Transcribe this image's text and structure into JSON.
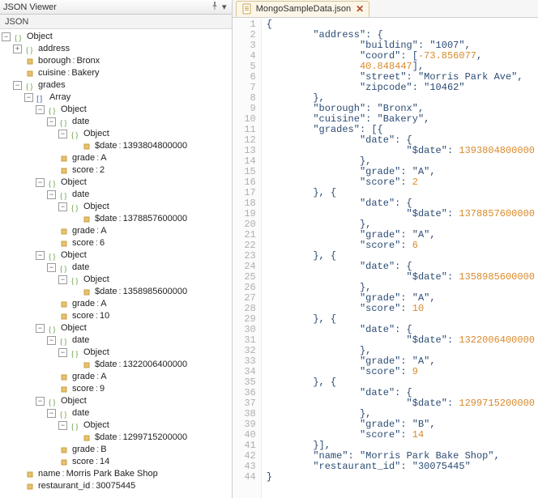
{
  "left": {
    "title": "JSON Viewer",
    "column_header": "JSON",
    "tree": {
      "root_label": "Object",
      "address_label": "address",
      "borough_label": "borough",
      "borough_value": "Bronx",
      "cuisine_label": "cuisine",
      "cuisine_value": "Bakery",
      "grades_label": "grades",
      "array_label": "Array",
      "object_label": "Object",
      "date_label": "date",
      "sdate_label": "$date",
      "grade_label": "grade",
      "score_label": "score",
      "grades": [
        {
          "sdate": "1393804800000",
          "grade": "A",
          "score": "2"
        },
        {
          "sdate": "1378857600000",
          "grade": "A",
          "score": "6"
        },
        {
          "sdate": "1358985600000",
          "grade": "A",
          "score": "10"
        },
        {
          "sdate": "1322006400000",
          "grade": "A",
          "score": "9"
        },
        {
          "sdate": "1299715200000",
          "grade": "B",
          "score": "14"
        }
      ],
      "name_label": "name",
      "name_value": "Morris Park Bake Shop",
      "rid_label": "restaurant_id",
      "rid_value": "30075445"
    }
  },
  "tab": {
    "filename": "MongoSampleData.json"
  },
  "chart_data": {
    "type": "table",
    "title": "Restaurant JSON document",
    "address": {
      "building": "1007",
      "coord": [
        -73.856077,
        40.848447
      ],
      "street": "Morris Park Ave",
      "zipcode": "10462"
    },
    "borough": "Bronx",
    "cuisine": "Bakery",
    "grades": [
      {
        "$date": 1393804800000,
        "grade": "A",
        "score": 2
      },
      {
        "$date": 1378857600000,
        "grade": "A",
        "score": 6
      },
      {
        "$date": 1358985600000,
        "grade": "A",
        "score": 10
      },
      {
        "$date": 1322006400000,
        "grade": "A",
        "score": 9
      },
      {
        "$date": 1299715200000,
        "grade": "B",
        "score": 14
      }
    ],
    "name": "Morris Park Bake Shop",
    "restaurant_id": "30075445"
  },
  "code": {
    "lines": [
      [
        [
          "punc",
          "{"
        ]
      ],
      [
        [
          "punc",
          "        "
        ],
        [
          "key",
          "\"address\""
        ],
        [
          "punc",
          ": {"
        ]
      ],
      [
        [
          "punc",
          "                "
        ],
        [
          "key",
          "\"building\""
        ],
        [
          "punc",
          ": "
        ],
        [
          "str",
          "\"1007\""
        ],
        [
          "punc",
          ","
        ]
      ],
      [
        [
          "punc",
          "                "
        ],
        [
          "key",
          "\"coord\""
        ],
        [
          "punc",
          ": ["
        ],
        [
          "num",
          "-73.856077"
        ],
        [
          "punc",
          ","
        ]
      ],
      [
        [
          "punc",
          "                "
        ],
        [
          "num",
          "40.848447"
        ],
        [
          "punc",
          "],"
        ]
      ],
      [
        [
          "punc",
          "                "
        ],
        [
          "key",
          "\"street\""
        ],
        [
          "punc",
          ": "
        ],
        [
          "str",
          "\"Morris Park Ave\""
        ],
        [
          "punc",
          ","
        ]
      ],
      [
        [
          "punc",
          "                "
        ],
        [
          "key",
          "\"zipcode\""
        ],
        [
          "punc",
          ": "
        ],
        [
          "str",
          "\"10462\""
        ]
      ],
      [
        [
          "punc",
          "        },"
        ]
      ],
      [
        [
          "punc",
          "        "
        ],
        [
          "key",
          "\"borough\""
        ],
        [
          "punc",
          ": "
        ],
        [
          "str",
          "\"Bronx\""
        ],
        [
          "punc",
          ","
        ]
      ],
      [
        [
          "punc",
          "        "
        ],
        [
          "key",
          "\"cuisine\""
        ],
        [
          "punc",
          ": "
        ],
        [
          "str",
          "\"Bakery\""
        ],
        [
          "punc",
          ","
        ]
      ],
      [
        [
          "punc",
          "        "
        ],
        [
          "key",
          "\"grades\""
        ],
        [
          "punc",
          ": [{"
        ]
      ],
      [
        [
          "punc",
          "                "
        ],
        [
          "key",
          "\"date\""
        ],
        [
          "punc",
          ": {"
        ]
      ],
      [
        [
          "punc",
          "                        "
        ],
        [
          "key",
          "\"$date\""
        ],
        [
          "punc",
          ": "
        ],
        [
          "num",
          "1393804800000"
        ]
      ],
      [
        [
          "punc",
          "                },"
        ]
      ],
      [
        [
          "punc",
          "                "
        ],
        [
          "key",
          "\"grade\""
        ],
        [
          "punc",
          ": "
        ],
        [
          "str",
          "\"A\""
        ],
        [
          "punc",
          ","
        ]
      ],
      [
        [
          "punc",
          "                "
        ],
        [
          "key",
          "\"score\""
        ],
        [
          "punc",
          ": "
        ],
        [
          "num",
          "2"
        ]
      ],
      [
        [
          "punc",
          "        }, {"
        ]
      ],
      [
        [
          "punc",
          "                "
        ],
        [
          "key",
          "\"date\""
        ],
        [
          "punc",
          ": {"
        ]
      ],
      [
        [
          "punc",
          "                        "
        ],
        [
          "key",
          "\"$date\""
        ],
        [
          "punc",
          ": "
        ],
        [
          "num",
          "1378857600000"
        ]
      ],
      [
        [
          "punc",
          "                },"
        ]
      ],
      [
        [
          "punc",
          "                "
        ],
        [
          "key",
          "\"grade\""
        ],
        [
          "punc",
          ": "
        ],
        [
          "str",
          "\"A\""
        ],
        [
          "punc",
          ","
        ]
      ],
      [
        [
          "punc",
          "                "
        ],
        [
          "key",
          "\"score\""
        ],
        [
          "punc",
          ": "
        ],
        [
          "num",
          "6"
        ]
      ],
      [
        [
          "punc",
          "        }, {"
        ]
      ],
      [
        [
          "punc",
          "                "
        ],
        [
          "key",
          "\"date\""
        ],
        [
          "punc",
          ": {"
        ]
      ],
      [
        [
          "punc",
          "                        "
        ],
        [
          "key",
          "\"$date\""
        ],
        [
          "punc",
          ": "
        ],
        [
          "num",
          "1358985600000"
        ]
      ],
      [
        [
          "punc",
          "                },"
        ]
      ],
      [
        [
          "punc",
          "                "
        ],
        [
          "key",
          "\"grade\""
        ],
        [
          "punc",
          ": "
        ],
        [
          "str",
          "\"A\""
        ],
        [
          "punc",
          ","
        ]
      ],
      [
        [
          "punc",
          "                "
        ],
        [
          "key",
          "\"score\""
        ],
        [
          "punc",
          ": "
        ],
        [
          "num",
          "10"
        ]
      ],
      [
        [
          "punc",
          "        }, {"
        ]
      ],
      [
        [
          "punc",
          "                "
        ],
        [
          "key",
          "\"date\""
        ],
        [
          "punc",
          ": {"
        ]
      ],
      [
        [
          "punc",
          "                        "
        ],
        [
          "key",
          "\"$date\""
        ],
        [
          "punc",
          ": "
        ],
        [
          "num",
          "1322006400000"
        ]
      ],
      [
        [
          "punc",
          "                },"
        ]
      ],
      [
        [
          "punc",
          "                "
        ],
        [
          "key",
          "\"grade\""
        ],
        [
          "punc",
          ": "
        ],
        [
          "str",
          "\"A\""
        ],
        [
          "punc",
          ","
        ]
      ],
      [
        [
          "punc",
          "                "
        ],
        [
          "key",
          "\"score\""
        ],
        [
          "punc",
          ": "
        ],
        [
          "num",
          "9"
        ]
      ],
      [
        [
          "punc",
          "        }, {"
        ]
      ],
      [
        [
          "punc",
          "                "
        ],
        [
          "key",
          "\"date\""
        ],
        [
          "punc",
          ": {"
        ]
      ],
      [
        [
          "punc",
          "                        "
        ],
        [
          "key",
          "\"$date\""
        ],
        [
          "punc",
          ": "
        ],
        [
          "num",
          "1299715200000"
        ]
      ],
      [
        [
          "punc",
          "                },"
        ]
      ],
      [
        [
          "punc",
          "                "
        ],
        [
          "key",
          "\"grade\""
        ],
        [
          "punc",
          ": "
        ],
        [
          "str",
          "\"B\""
        ],
        [
          "punc",
          ","
        ]
      ],
      [
        [
          "punc",
          "                "
        ],
        [
          "key",
          "\"score\""
        ],
        [
          "punc",
          ": "
        ],
        [
          "num",
          "14"
        ]
      ],
      [
        [
          "punc",
          "        }],"
        ]
      ],
      [
        [
          "punc",
          "        "
        ],
        [
          "key",
          "\"name\""
        ],
        [
          "punc",
          ": "
        ],
        [
          "str",
          "\"Morris Park Bake Shop\""
        ],
        [
          "punc",
          ","
        ]
      ],
      [
        [
          "punc",
          "        "
        ],
        [
          "key",
          "\"restaurant_id\""
        ],
        [
          "punc",
          ": "
        ],
        [
          "str",
          "\"30075445\""
        ]
      ],
      [
        [
          "punc",
          "}"
        ]
      ]
    ]
  }
}
